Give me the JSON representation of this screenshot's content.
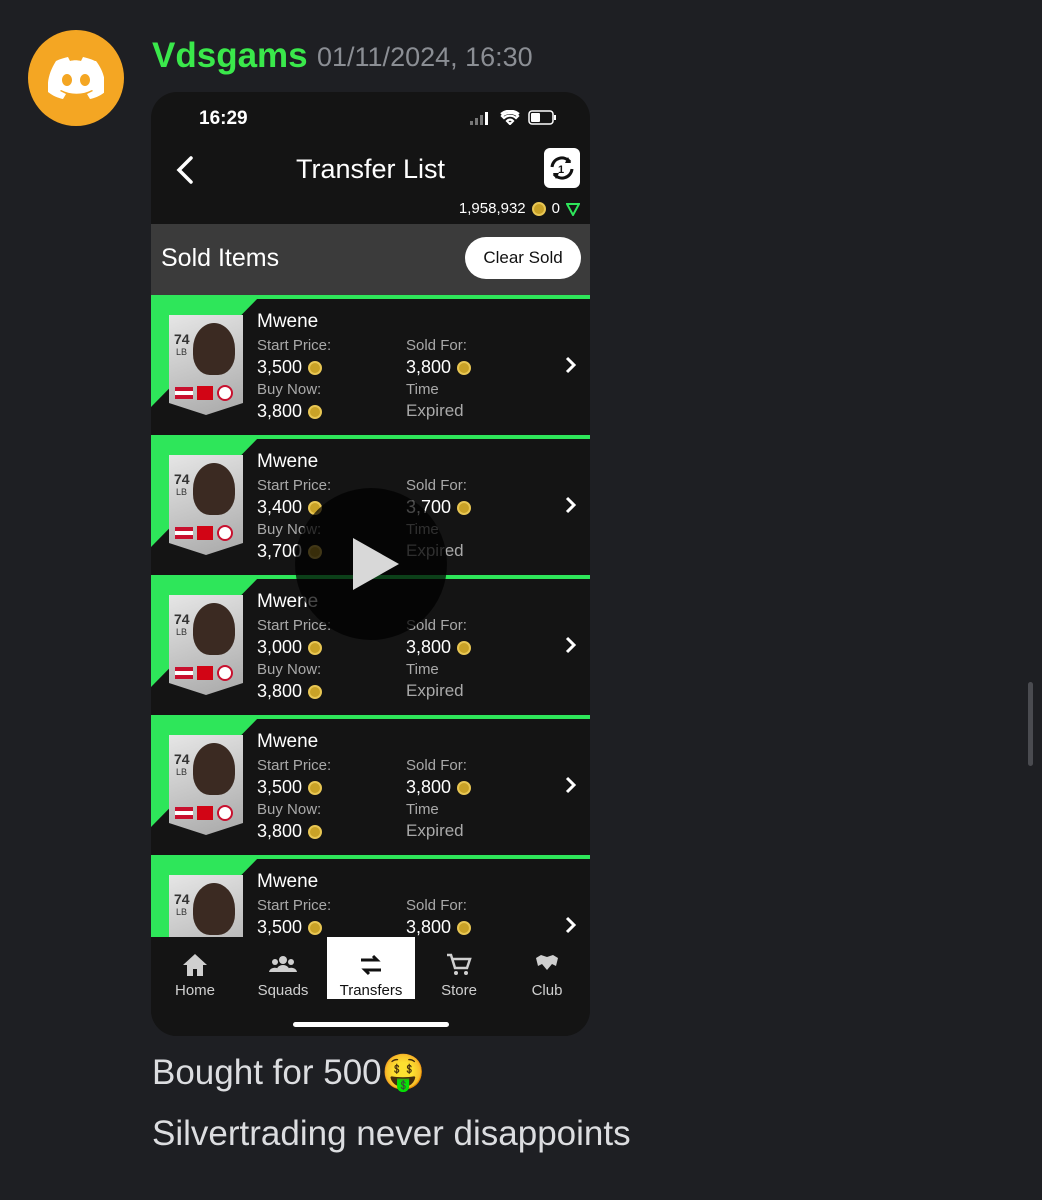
{
  "message": {
    "author": "Vdsgams",
    "timestamp": "01/11/2024, 16:30",
    "lines": [
      "Bought for 500🤑",
      "Silvertrading never disappoints"
    ]
  },
  "phone": {
    "status_time": "16:29",
    "title": "Transfer List",
    "coins": "1,958,932",
    "points": "0",
    "section_title": "Sold Items",
    "clear_button": "Clear Sold",
    "labels": {
      "start_price": "Start Price:",
      "buy_now": "Buy Now:",
      "sold_for": "Sold For:",
      "time": "Time"
    },
    "items": [
      {
        "name": "Mwene",
        "rating": "74",
        "position": "LB",
        "start_price": "3,500",
        "buy_now": "3,800",
        "sold_for": "3,800",
        "time": "Expired"
      },
      {
        "name": "Mwene",
        "rating": "74",
        "position": "LB",
        "start_price": "3,400",
        "buy_now": "3,700",
        "sold_for": "3,700",
        "time": "Expired"
      },
      {
        "name": "Mwene",
        "rating": "74",
        "position": "LB",
        "start_price": "3,000",
        "buy_now": "3,800",
        "sold_for": "3,800",
        "time": "Expired"
      },
      {
        "name": "Mwene",
        "rating": "74",
        "position": "LB",
        "start_price": "3,500",
        "buy_now": "3,800",
        "sold_for": "3,800",
        "time": "Expired"
      },
      {
        "name": "Mwene",
        "rating": "74",
        "position": "LB",
        "start_price": "3,500",
        "buy_now": "",
        "sold_for": "3,800",
        "time": ""
      }
    ],
    "nav": [
      {
        "label": "Home",
        "icon": "home-icon"
      },
      {
        "label": "Squads",
        "icon": "squads-icon"
      },
      {
        "label": "Transfers",
        "icon": "transfers-icon",
        "active": true
      },
      {
        "label": "Store",
        "icon": "store-icon"
      },
      {
        "label": "Club",
        "icon": "club-icon"
      }
    ]
  },
  "colors": {
    "author": "#3ae84b",
    "accent_green": "#2ee65a",
    "avatar": "#f4a623"
  }
}
